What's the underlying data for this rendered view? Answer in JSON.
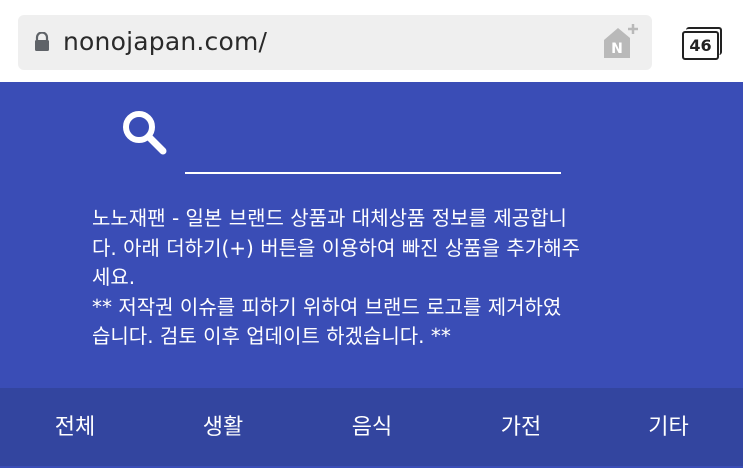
{
  "browser": {
    "url": "nonojapan.com/",
    "naver_badge": "N",
    "tab_count": "46"
  },
  "search": {
    "placeholder": ""
  },
  "description": {
    "lines": [
      "노노재팬 - 일본 브랜드 상품과 대체상품 정보를 제공합니",
      "다. 아래 더하기(+) 버튼을 이용하여 빠진 상품을 추가해주",
      "세요.",
      "** 저작권 이슈를 피하기 위하여 브랜드 로고를 제거하였",
      "습니다. 검토 이후 업데이트 하겠습니다. **"
    ]
  },
  "nav": {
    "items": [
      "전체",
      "생활",
      "음식",
      "가전",
      "기타"
    ]
  }
}
